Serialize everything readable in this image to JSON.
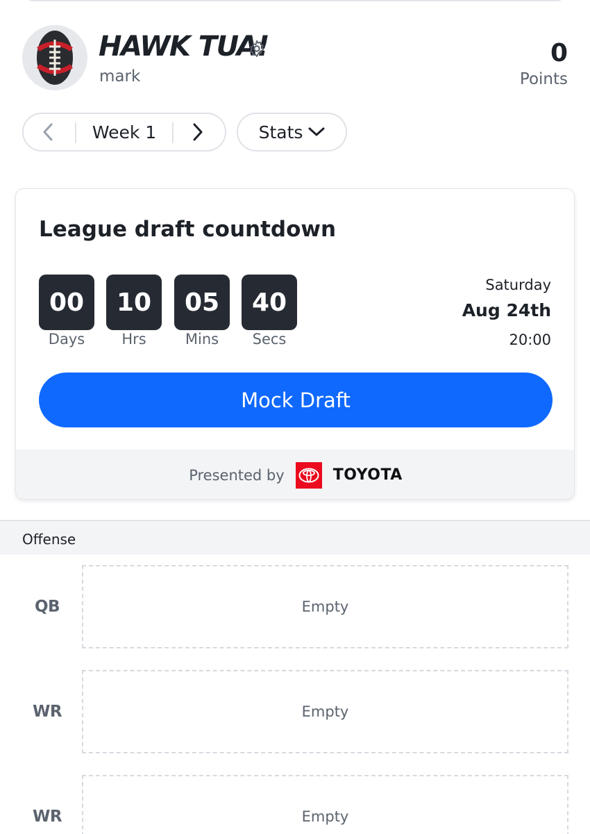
{
  "header": {
    "team_name": "HAWK TUA!",
    "manager": "mark",
    "points_value": "0",
    "points_label": "Points"
  },
  "week_selector": {
    "label": "Week 1"
  },
  "stats_dropdown": {
    "label": "Stats"
  },
  "countdown": {
    "title": "League draft countdown",
    "units": [
      {
        "value": "00",
        "label": "Days"
      },
      {
        "value": "10",
        "label": "Hrs"
      },
      {
        "value": "05",
        "label": "Mins"
      },
      {
        "value": "40",
        "label": "Secs"
      }
    ],
    "day": "Saturday",
    "date": "Aug 24th",
    "time": "20:00",
    "button_label": "Mock Draft",
    "presented_by": "Presented by",
    "sponsor": "TOYOTA"
  },
  "colors": {
    "primary_button": "#0f69ff",
    "timer_bg": "#262b33",
    "toyota_red": "#eb0a1e"
  },
  "section": {
    "label": "Offense"
  },
  "slots": [
    {
      "position": "QB",
      "status": "Empty"
    },
    {
      "position": "WR",
      "status": "Empty"
    },
    {
      "position": "WR",
      "status": "Empty"
    }
  ],
  "icons": {
    "avatar": "football-icon",
    "settings": "gear-icon",
    "prev": "chevron-left-icon",
    "next": "chevron-right-icon",
    "dropdown": "chevron-down-icon",
    "sponsor_logo": "toyota-logo-icon"
  }
}
